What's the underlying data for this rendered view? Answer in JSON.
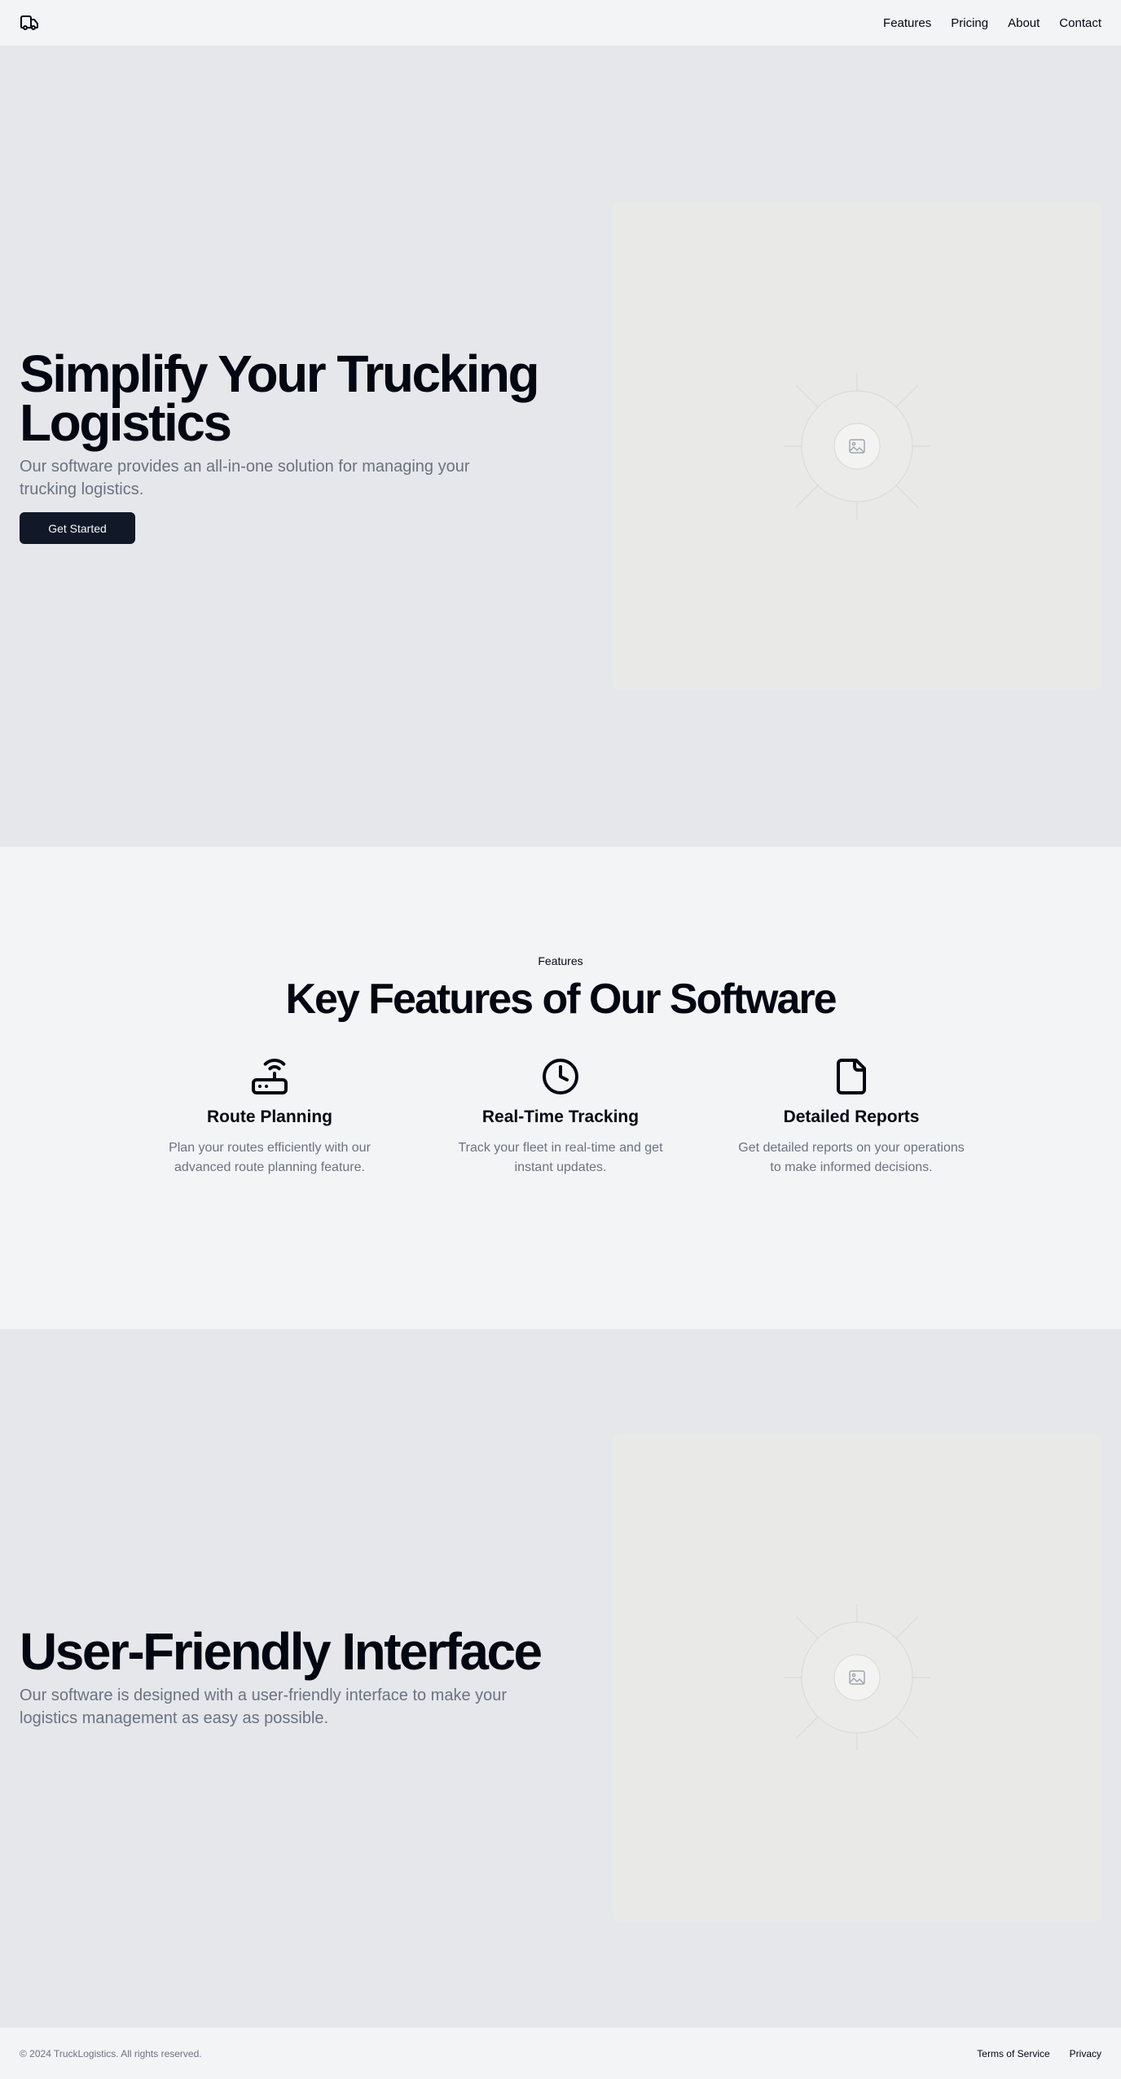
{
  "header": {
    "logo_icon": "truck-icon",
    "nav": [
      {
        "label": "Features"
      },
      {
        "label": "Pricing"
      },
      {
        "label": "About"
      },
      {
        "label": "Contact"
      }
    ]
  },
  "hero": {
    "title": "Simplify Your Trucking Logistics",
    "subtitle": "Our software provides an all-in-one solution for managing your trucking logistics.",
    "cta_label": "Get Started",
    "image_icon": "image-placeholder-icon"
  },
  "features": {
    "kicker": "Features",
    "title": "Key Features of Our Software",
    "items": [
      {
        "icon": "router-icon",
        "title": "Route Planning",
        "description": "Plan your routes efficiently with our advanced route planning feature."
      },
      {
        "icon": "clock-icon",
        "title": "Real-Time Tracking",
        "description": "Track your fleet in real-time and get instant updates."
      },
      {
        "icon": "file-icon",
        "title": "Detailed Reports",
        "description": "Get detailed reports on your operations to make informed decisions."
      }
    ]
  },
  "interface": {
    "title": "User-Friendly Interface",
    "subtitle": "Our software is designed with a user-friendly interface to make your logistics management as easy as possible.",
    "image_icon": "image-placeholder-icon"
  },
  "footer": {
    "copyright": "© 2024 TruckLogistics. All rights reserved.",
    "links": [
      {
        "label": "Terms of Service"
      },
      {
        "label": "Privacy"
      }
    ]
  },
  "colors": {
    "primary_button": "#111827",
    "text": "#030712",
    "muted_text": "#6b7280",
    "section_gray": "#e5e7eb",
    "page_bg": "#f3f4f6"
  }
}
